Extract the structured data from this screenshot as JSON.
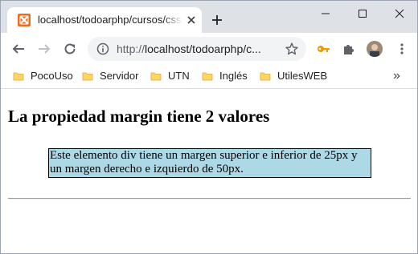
{
  "browser": {
    "tab": {
      "title": "localhost/todoarphp/cursos/css/ej",
      "favicon": "xampp-favicon-icon"
    },
    "toolbar": {
      "url_scheme": "http://",
      "url_rest": "localhost/todoarphp/c..."
    },
    "bookmarks": [
      {
        "label": "PocoUso"
      },
      {
        "label": "Servidor"
      },
      {
        "label": "UTN"
      },
      {
        "label": "Inglés"
      },
      {
        "label": "UtilesWEB"
      }
    ],
    "more_bookmarks": "»"
  },
  "page": {
    "heading": "La propiedad margin tiene 2 valores",
    "box_text": "Este elemento div tiene un margen superior e inferior de 25px y un margen derecho e izquierdo de 50px.",
    "box_color": "#add8e6"
  }
}
